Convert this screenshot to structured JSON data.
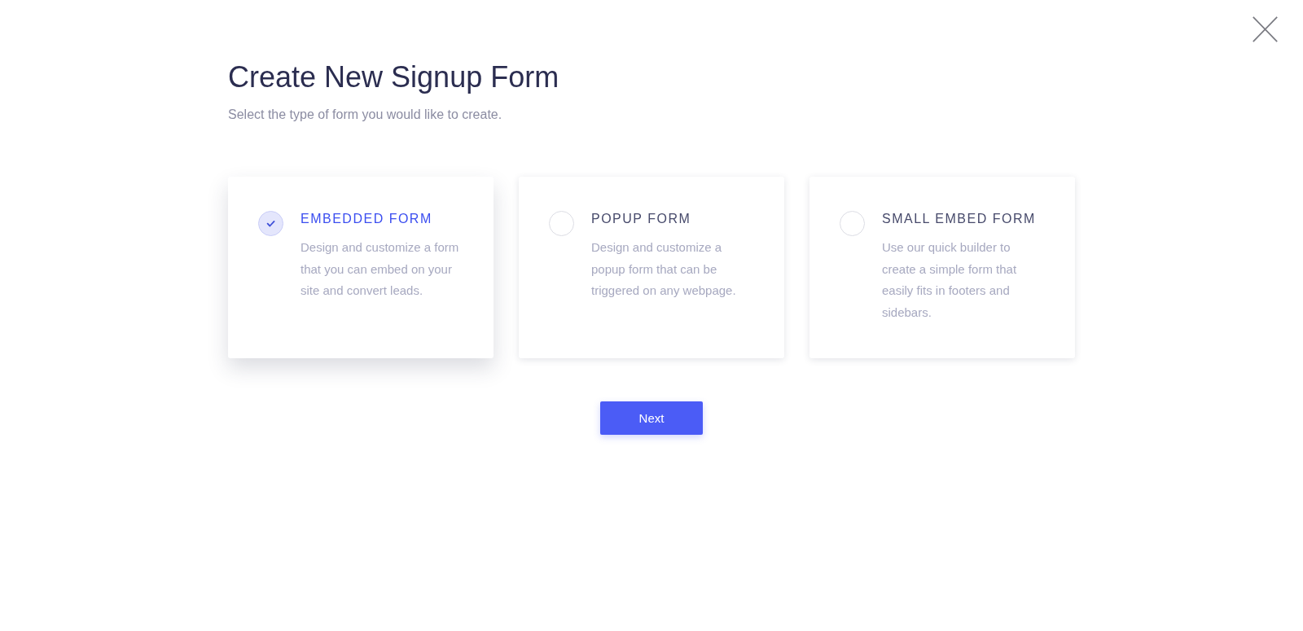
{
  "dialog": {
    "title": "Create New Signup Form",
    "subtitle": "Select the type of form you would like to create."
  },
  "form_types": [
    {
      "name": "EMBEDDED FORM",
      "description": "Design and customize a form that you can embed on your site and convert leads.",
      "selected": true
    },
    {
      "name": "POPUP FORM",
      "description": "Design and customize a popup form that can be triggered on any webpage.",
      "selected": false
    },
    {
      "name": "SMALL EMBED FORM",
      "description": "Use our quick builder to create a simple form that easily fits in footers and sidebars.",
      "selected": false
    }
  ],
  "buttons": [
    "Next"
  ]
}
